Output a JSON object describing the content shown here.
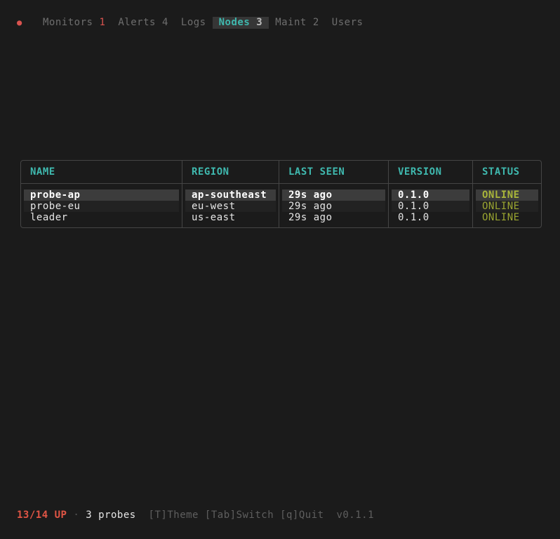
{
  "tabs": [
    {
      "label": "Monitors",
      "count": "1",
      "alert": true,
      "active": false
    },
    {
      "label": "Alerts",
      "count": "4",
      "alert": false,
      "active": false
    },
    {
      "label": "Logs",
      "count": "",
      "alert": false,
      "active": false
    },
    {
      "label": "Nodes",
      "count": "3",
      "alert": false,
      "active": true
    },
    {
      "label": "Maint",
      "count": "2",
      "alert": false,
      "active": false
    },
    {
      "label": "Users",
      "count": "",
      "alert": false,
      "active": false
    }
  ],
  "status_dot": "●",
  "table": {
    "columns": [
      "NAME",
      "REGION",
      "LAST SEEN",
      "VERSION",
      "STATUS"
    ],
    "rows": [
      {
        "name": "probe-ap",
        "region": "ap-southeast",
        "last_seen": "29s ago",
        "version": "0.1.0",
        "status": "ONLINE",
        "selected": true
      },
      {
        "name": "probe-eu",
        "region": "eu-west",
        "last_seen": "29s ago",
        "version": "0.1.0",
        "status": "ONLINE",
        "selected": false
      },
      {
        "name": "leader",
        "region": "us-east",
        "last_seen": "29s ago",
        "version": "0.1.0",
        "status": "ONLINE",
        "selected": false
      }
    ]
  },
  "footer": {
    "up": "13/14 UP",
    "separator": "·",
    "probes": "3 probes",
    "key_theme": "[T]Theme",
    "key_switch": "[Tab]Switch",
    "key_quit": "[q]Quit",
    "version": "v0.1.1"
  },
  "colors": {
    "accent": "#3fb8ae",
    "alert": "#d9534f",
    "online": "#9aa531",
    "background": "#1b1b1b"
  }
}
